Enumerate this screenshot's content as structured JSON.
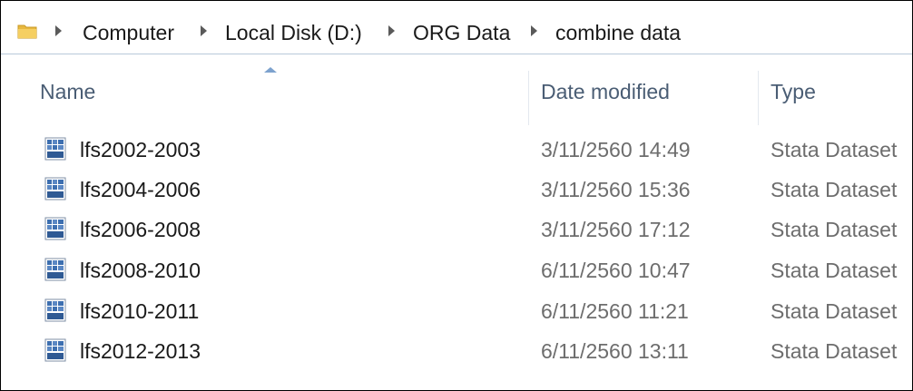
{
  "breadcrumb": {
    "icon": "folder-icon",
    "items": [
      "Computer",
      "Local Disk (D:)",
      "ORG Data",
      "combine data"
    ]
  },
  "columns": {
    "name": "Name",
    "date_modified": "Date modified",
    "type": "Type",
    "sort": "name-ascending"
  },
  "files": [
    {
      "name": "lfs2002-2003",
      "date": "3/11/2560 14:49",
      "type": "Stata Dataset",
      "icon": "stata-dataset-icon"
    },
    {
      "name": "lfs2004-2006",
      "date": "3/11/2560 15:36",
      "type": "Stata Dataset",
      "icon": "stata-dataset-icon"
    },
    {
      "name": "lfs2006-2008",
      "date": "3/11/2560 17:12",
      "type": "Stata Dataset",
      "icon": "stata-dataset-icon"
    },
    {
      "name": "lfs2008-2010",
      "date": "6/11/2560 10:47",
      "type": "Stata Dataset",
      "icon": "stata-dataset-icon"
    },
    {
      "name": "lfs2010-2011",
      "date": "6/11/2560 11:21",
      "type": "Stata Dataset",
      "icon": "stata-dataset-icon"
    },
    {
      "name": "lfs2012-2013",
      "date": "6/11/2560 13:11",
      "type": "Stata Dataset",
      "icon": "stata-dataset-icon"
    }
  ],
  "colors": {
    "header_text": "#4a5d74",
    "secondary_text": "#6d6d6d",
    "folder": "#e8b83f",
    "sort_arrow": "#7da2ce"
  }
}
